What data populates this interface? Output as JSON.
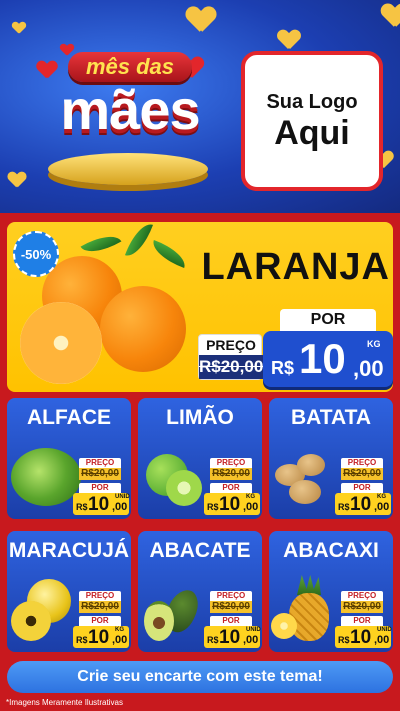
{
  "header": {
    "logo_line1": "Sua Logo",
    "logo_line2": "Aqui",
    "badge_top": "mês das",
    "badge_bottom": "mães"
  },
  "hero": {
    "discount": "-50%",
    "product": "LARANJA",
    "old_label": "PREÇO",
    "old_price": "R$20,00",
    "new_label": "POR",
    "currency": "R$",
    "price_int": "10",
    "price_dec": ",00",
    "unit": "KG"
  },
  "products": [
    {
      "name": "ALFACE",
      "old_label": "PREÇO",
      "old_price": "R$20,00",
      "new_label": "POR",
      "currency": "R$",
      "price_int": "10",
      "price_dec": ",00",
      "unit": "UNID"
    },
    {
      "name": "LIMÃO",
      "old_label": "PREÇO",
      "old_price": "R$20,00",
      "new_label": "POR",
      "currency": "R$",
      "price_int": "10",
      "price_dec": ",00",
      "unit": "KG"
    },
    {
      "name": "BATATA",
      "old_label": "PREÇO",
      "old_price": "R$20,00",
      "new_label": "POR",
      "currency": "R$",
      "price_int": "10",
      "price_dec": ",00",
      "unit": "KG"
    },
    {
      "name": "MARACUJÁ",
      "old_label": "PREÇO",
      "old_price": "R$20,00",
      "new_label": "POR",
      "currency": "R$",
      "price_int": "10",
      "price_dec": ",00",
      "unit": "KG"
    },
    {
      "name": "ABACATE",
      "old_label": "PREÇO",
      "old_price": "R$20,00",
      "new_label": "POR",
      "currency": "R$",
      "price_int": "10",
      "price_dec": ",00",
      "unit": "UNID"
    },
    {
      "name": "ABACAXI",
      "old_label": "PREÇO",
      "old_price": "R$20,00",
      "new_label": "POR",
      "currency": "R$",
      "price_int": "10",
      "price_dec": ",00",
      "unit": "UNID"
    }
  ],
  "footer": {
    "cta": "Crie seu encarte com este tema!",
    "disclaimer": "*Imagens Meramente Ilustrativas"
  },
  "colors": {
    "background_red": "#c8191e",
    "header_blue": "#1c3fb2",
    "hero_yellow": "#ffc200",
    "card_blue": "#2f63e0",
    "price_yellow": "#ffd21f"
  },
  "icons": [
    "heart-icon",
    "orange-image",
    "lettuce-image",
    "lime-image",
    "potato-image",
    "passion-fruit-image",
    "avocado-image",
    "pineapple-image"
  ]
}
